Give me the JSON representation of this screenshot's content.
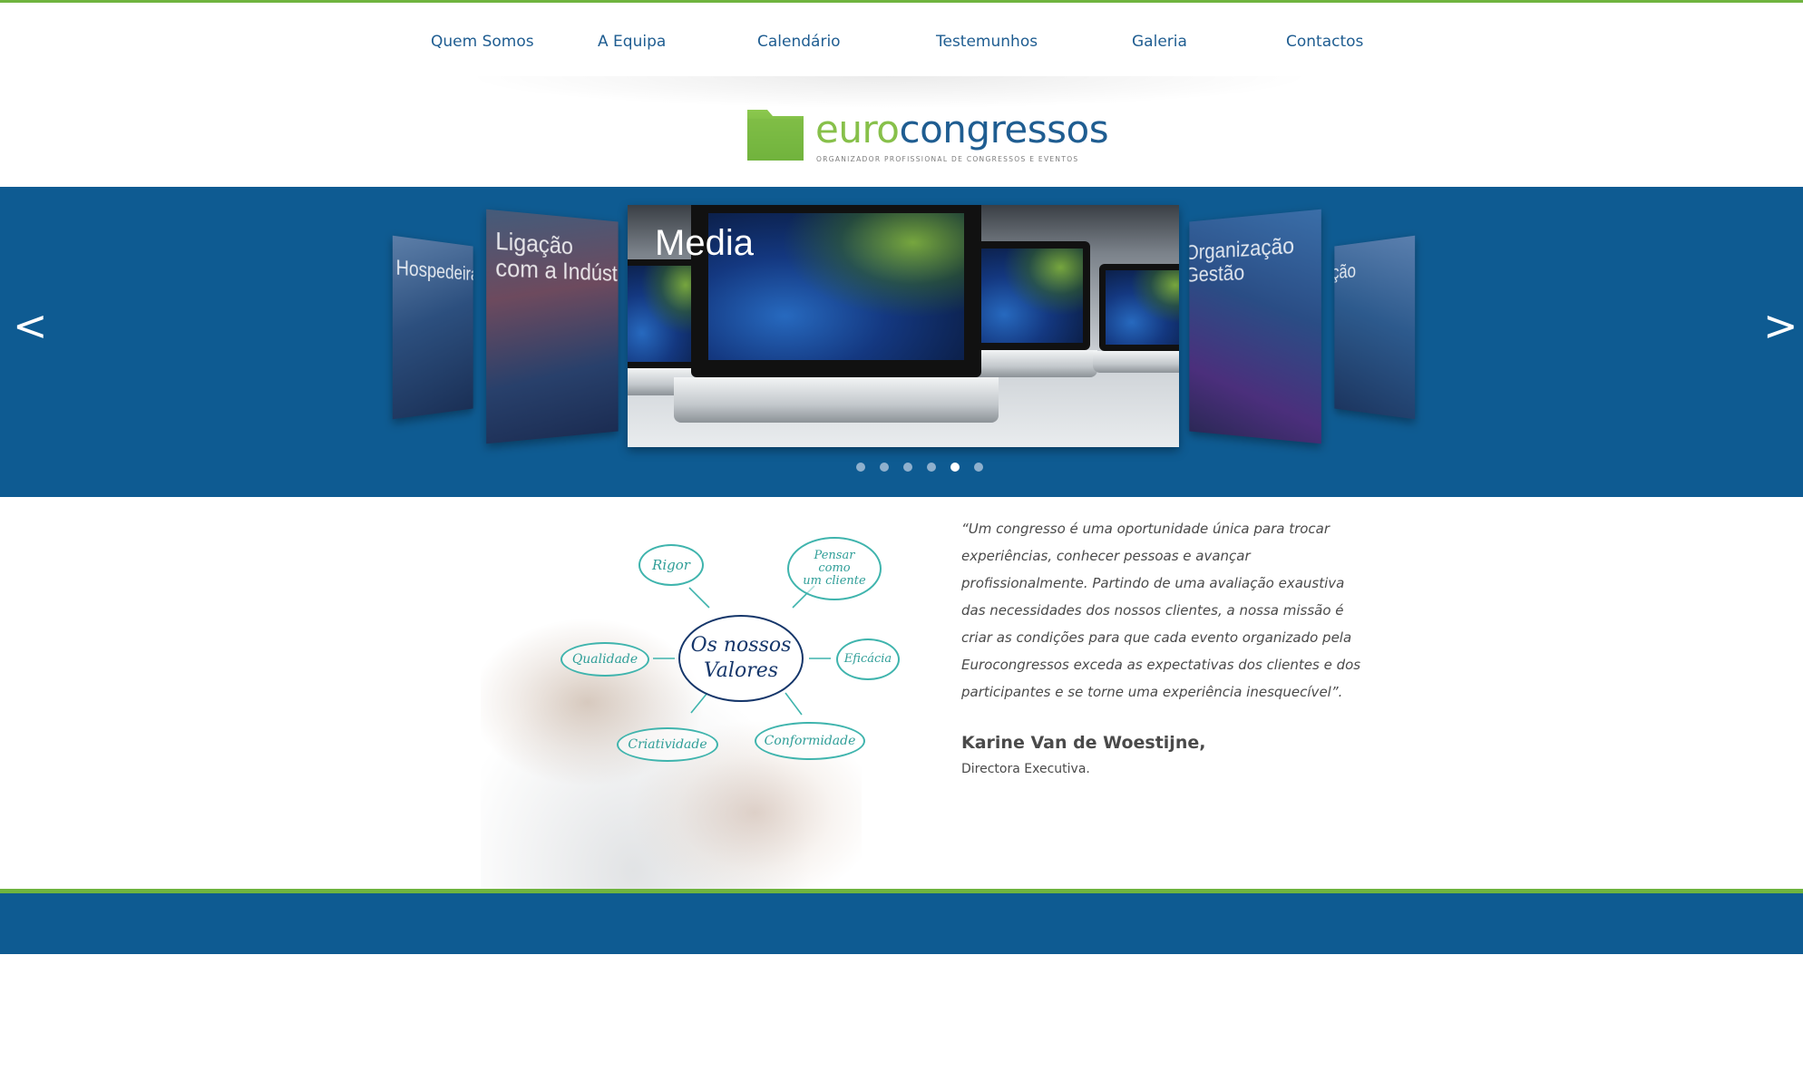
{
  "nav": {
    "items": [
      {
        "label": "Quem Somos"
      },
      {
        "label": "A Equipa"
      },
      {
        "label": "Calendário"
      },
      {
        "label": "Testemunhos"
      },
      {
        "label": "Galeria"
      },
      {
        "label": "Contactos"
      }
    ]
  },
  "logo": {
    "euro": "euro",
    "congressos": "congressos",
    "subtitle": "ORGANIZADOR PROFISSIONAL DE CONGRESSOS E EVENTOS"
  },
  "slider": {
    "prev": "<",
    "next": ">",
    "active_index": 4,
    "dot_count": 6,
    "slides": [
      {
        "caption": "Hospedeiras"
      },
      {
        "caption": "Ligação\ncom a Indústria"
      },
      {
        "caption": "Media"
      },
      {
        "caption": "Organização\nGestão"
      },
      {
        "caption": "ção"
      }
    ]
  },
  "values": {
    "center": "Os nossos\nValores",
    "items": [
      "Rigor",
      "Pensar\ncomo\num cliente",
      "Qualidade",
      "Eficácia",
      "Criatividade",
      "Conformidade"
    ]
  },
  "quote": {
    "text": "“Um congresso é uma oportunidade única para trocar experiências, conhecer pessoas e avançar profissionalmente. Partindo de uma avaliação exaustiva das necessidades dos nossos clientes, a nossa missão é criar as condições para que cada evento organizado pela Eurocongressos exceda as expectativas dos clientes e dos participantes e se torne uma experiência inesquecível”.",
    "author": "Karine Van de Woestijne,",
    "role": "Directora Executiva."
  },
  "colors": {
    "green": "#6fb43f",
    "blue": "#0e5b92",
    "nav_text": "#1f5d91",
    "teal": "#3fb4ad"
  }
}
